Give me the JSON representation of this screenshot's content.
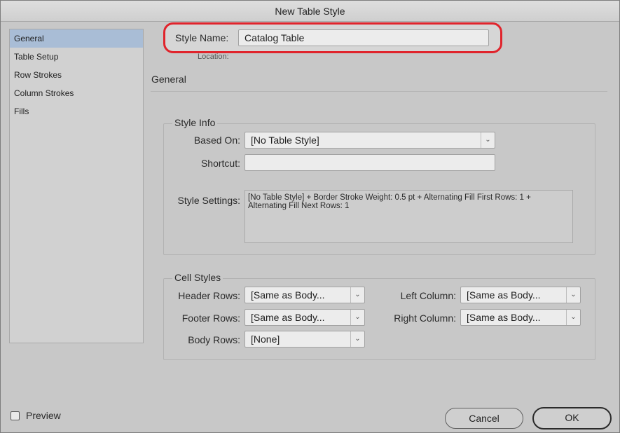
{
  "window": {
    "title": "New Table Style"
  },
  "sidebar": {
    "items": [
      {
        "label": "General"
      },
      {
        "label": "Table Setup"
      },
      {
        "label": "Row Strokes"
      },
      {
        "label": "Column Strokes"
      },
      {
        "label": "Fills"
      }
    ]
  },
  "header": {
    "style_name_label": "Style Name:",
    "style_name_value": "Catalog Table",
    "location_label": "Location:",
    "highlight_color": "#e0242c"
  },
  "section": {
    "title": "General"
  },
  "style_info": {
    "title": "Style Info",
    "based_on_label": "Based On:",
    "based_on_value": "[No Table Style]",
    "shortcut_label": "Shortcut:",
    "shortcut_value": "",
    "style_settings_label": "Style Settings:",
    "style_settings_text": "[No Table Style] + Border Stroke Weight: 0.5 pt + Alternating Fill First Rows: 1 + Alternating Fill Next Rows: 1"
  },
  "cell_styles": {
    "title": "Cell Styles",
    "header_rows_label": "Header Rows:",
    "header_rows_value": "[Same as Body...",
    "footer_rows_label": "Footer Rows:",
    "footer_rows_value": "[Same as Body...",
    "body_rows_label": "Body Rows:",
    "body_rows_value": "[None]",
    "left_column_label": "Left Column:",
    "left_column_value": "[Same as Body...",
    "right_column_label": "Right Column:",
    "right_column_value": "[Same as Body..."
  },
  "footer": {
    "preview_label": "Preview",
    "preview_checked": false,
    "cancel_label": "Cancel",
    "ok_label": "OK"
  },
  "icons": {
    "dropdown": "chevron-down-icon",
    "checkbox": "checkbox-icon"
  }
}
